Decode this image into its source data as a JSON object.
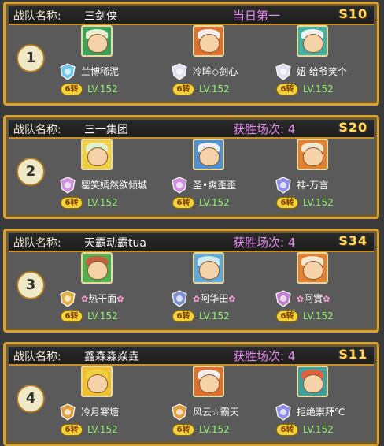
{
  "header_label": "战队名称:",
  "teams": [
    {
      "name": "三剑侠",
      "status": "当日第一",
      "server": "S10",
      "rank": "1",
      "members": [
        {
          "name": "兰博稀泥",
          "turn": "6转",
          "level": "LV.152",
          "hair": "#e8f0d0",
          "bg": "#3aa05a",
          "badge": "#70c8e8",
          "deco": false
        },
        {
          "name": "冷眸◇剑心",
          "turn": "6转",
          "level": "LV.152",
          "hair": "#f0f0f0",
          "bg": "#e07030",
          "badge": "#e0e0f0",
          "deco": false
        },
        {
          "name": "妞 给爷笑个",
          "turn": "6转",
          "level": "LV.152",
          "hair": "#f0f0f0",
          "bg": "#40b0a0",
          "badge": "#e0e0f0",
          "deco": false
        }
      ]
    },
    {
      "name": "三一集团",
      "status": "获胜场次: 4",
      "server": "S20",
      "rank": "2",
      "members": [
        {
          "name": "罂笑嫣然欲倾城",
          "turn": "6转",
          "level": "LV.152",
          "hair": "#e0f0d0",
          "bg": "#f0d040",
          "badge": "#d090e0",
          "deco": false
        },
        {
          "name": "圣•爽歪歪",
          "turn": "6转",
          "level": "LV.152",
          "hair": "#f0f0f0",
          "bg": "#5090d0",
          "badge": "#d090e0",
          "deco": false
        },
        {
          "name": "神-万言",
          "turn": "6转",
          "level": "LV.152",
          "hair": "#f0e8d0",
          "bg": "#e08030",
          "badge": "#9090e8",
          "deco": false
        }
      ]
    },
    {
      "name": "天霸动霸tua",
      "status": "获胜场次: 4",
      "server": "S34",
      "rank": "3",
      "members": [
        {
          "name": "热干面",
          "turn": "6转",
          "level": "LV.152",
          "hair": "#c06040",
          "bg": "#50b050",
          "badge": "#e0b040",
          "deco": true
        },
        {
          "name": "阿华田",
          "turn": "6转",
          "level": "LV.152",
          "hair": "#d0e8f0",
          "bg": "#60a8d8",
          "badge": "#8090d0",
          "deco": true
        },
        {
          "name": "阿實",
          "turn": "6转",
          "level": "LV.152",
          "hair": "#f0e8d0",
          "bg": "#e08030",
          "badge": "#c080d0",
          "deco": true
        }
      ]
    },
    {
      "name": "鑫森淼焱垚",
      "status": "获胜场次: 4",
      "server": "S11",
      "rank": "4",
      "members": [
        {
          "name": "冷月寒塘",
          "turn": "6转",
          "level": "LV.152",
          "hair": "#f0d040",
          "bg": "#f0c030",
          "badge": "#e0a040",
          "deco": false
        },
        {
          "name": "风云☆霸天",
          "turn": "6转",
          "level": "LV.152",
          "hair": "#f0f0f0",
          "bg": "#e07030",
          "badge": "#e0a040",
          "deco": false
        },
        {
          "name": "拒绝崇拜℃",
          "turn": "6转",
          "level": "LV.152",
          "hair": "#e06040",
          "bg": "#40a0a0",
          "badge": "#9090e8",
          "deco": false
        }
      ]
    }
  ]
}
